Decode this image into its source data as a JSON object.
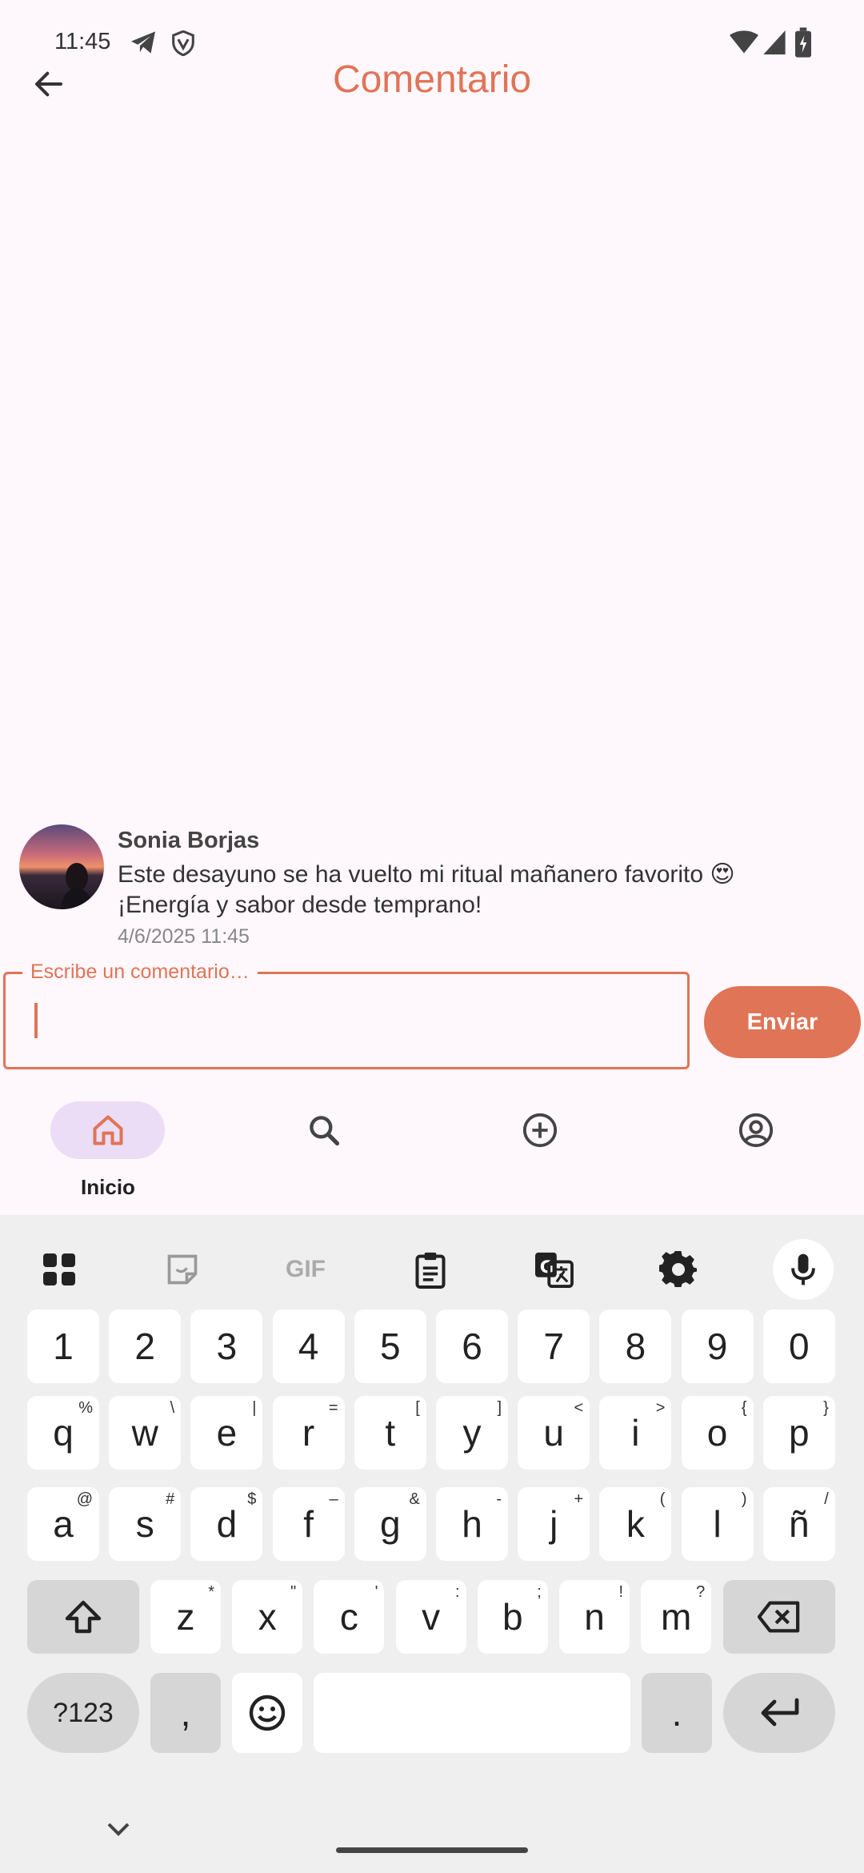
{
  "status_bar": {
    "time": "11:45",
    "icons_left": [
      "telegram-icon",
      "vpn-shield-icon"
    ],
    "icons_right": [
      "wifi-icon",
      "signal-icon",
      "battery-icon"
    ]
  },
  "app_bar": {
    "title": "Comentario",
    "back_icon": "arrow-left-icon"
  },
  "comment": {
    "author": "Sonia Borjas",
    "text": "Este desayuno se ha vuelto mi ritual mañanero favorito 😍 ¡Energía y sabor desde temprano!",
    "date": "4/6/2025 11:45"
  },
  "input": {
    "label": "Escribe un comentario…",
    "value": "",
    "send_label": "Enviar"
  },
  "bottom_nav": {
    "items": [
      {
        "icon": "home-icon",
        "label": "Inicio",
        "active": true
      },
      {
        "icon": "search-icon",
        "label": "",
        "active": false
      },
      {
        "icon": "add-circle-icon",
        "label": "",
        "active": false
      },
      {
        "icon": "account-circle-icon",
        "label": "",
        "active": false
      }
    ]
  },
  "keyboard": {
    "toolbar": [
      "apps-grid-icon",
      "sticker-icon",
      "gif-icon",
      "clipboard-icon",
      "translate-icon",
      "settings-icon",
      "mic-icon"
    ],
    "gif_label": "GIF",
    "row_numbers": [
      "1",
      "2",
      "3",
      "4",
      "5",
      "6",
      "7",
      "8",
      "9",
      "0"
    ],
    "row1": [
      {
        "k": "q",
        "s": "%"
      },
      {
        "k": "w",
        "s": "\\"
      },
      {
        "k": "e",
        "s": "|"
      },
      {
        "k": "r",
        "s": "="
      },
      {
        "k": "t",
        "s": "["
      },
      {
        "k": "y",
        "s": "]"
      },
      {
        "k": "u",
        "s": "<"
      },
      {
        "k": "i",
        "s": ">"
      },
      {
        "k": "o",
        "s": "{"
      },
      {
        "k": "p",
        "s": "}"
      }
    ],
    "row2": [
      {
        "k": "a",
        "s": "@"
      },
      {
        "k": "s",
        "s": "#"
      },
      {
        "k": "d",
        "s": "$"
      },
      {
        "k": "f",
        "s": "–"
      },
      {
        "k": "g",
        "s": "&"
      },
      {
        "k": "h",
        "s": "-"
      },
      {
        "k": "j",
        "s": "+"
      },
      {
        "k": "k",
        "s": "("
      },
      {
        "k": "l",
        "s": ")"
      },
      {
        "k": "ñ",
        "s": "/"
      }
    ],
    "row3": [
      {
        "k": "z",
        "s": "*"
      },
      {
        "k": "x",
        "s": "\""
      },
      {
        "k": "c",
        "s": "'"
      },
      {
        "k": "v",
        "s": ":"
      },
      {
        "k": "b",
        "s": ";"
      },
      {
        "k": "n",
        "s": "!"
      },
      {
        "k": "m",
        "s": "?"
      }
    ],
    "symbols_label": "?123",
    "comma_label": ",",
    "period_label": "."
  }
}
